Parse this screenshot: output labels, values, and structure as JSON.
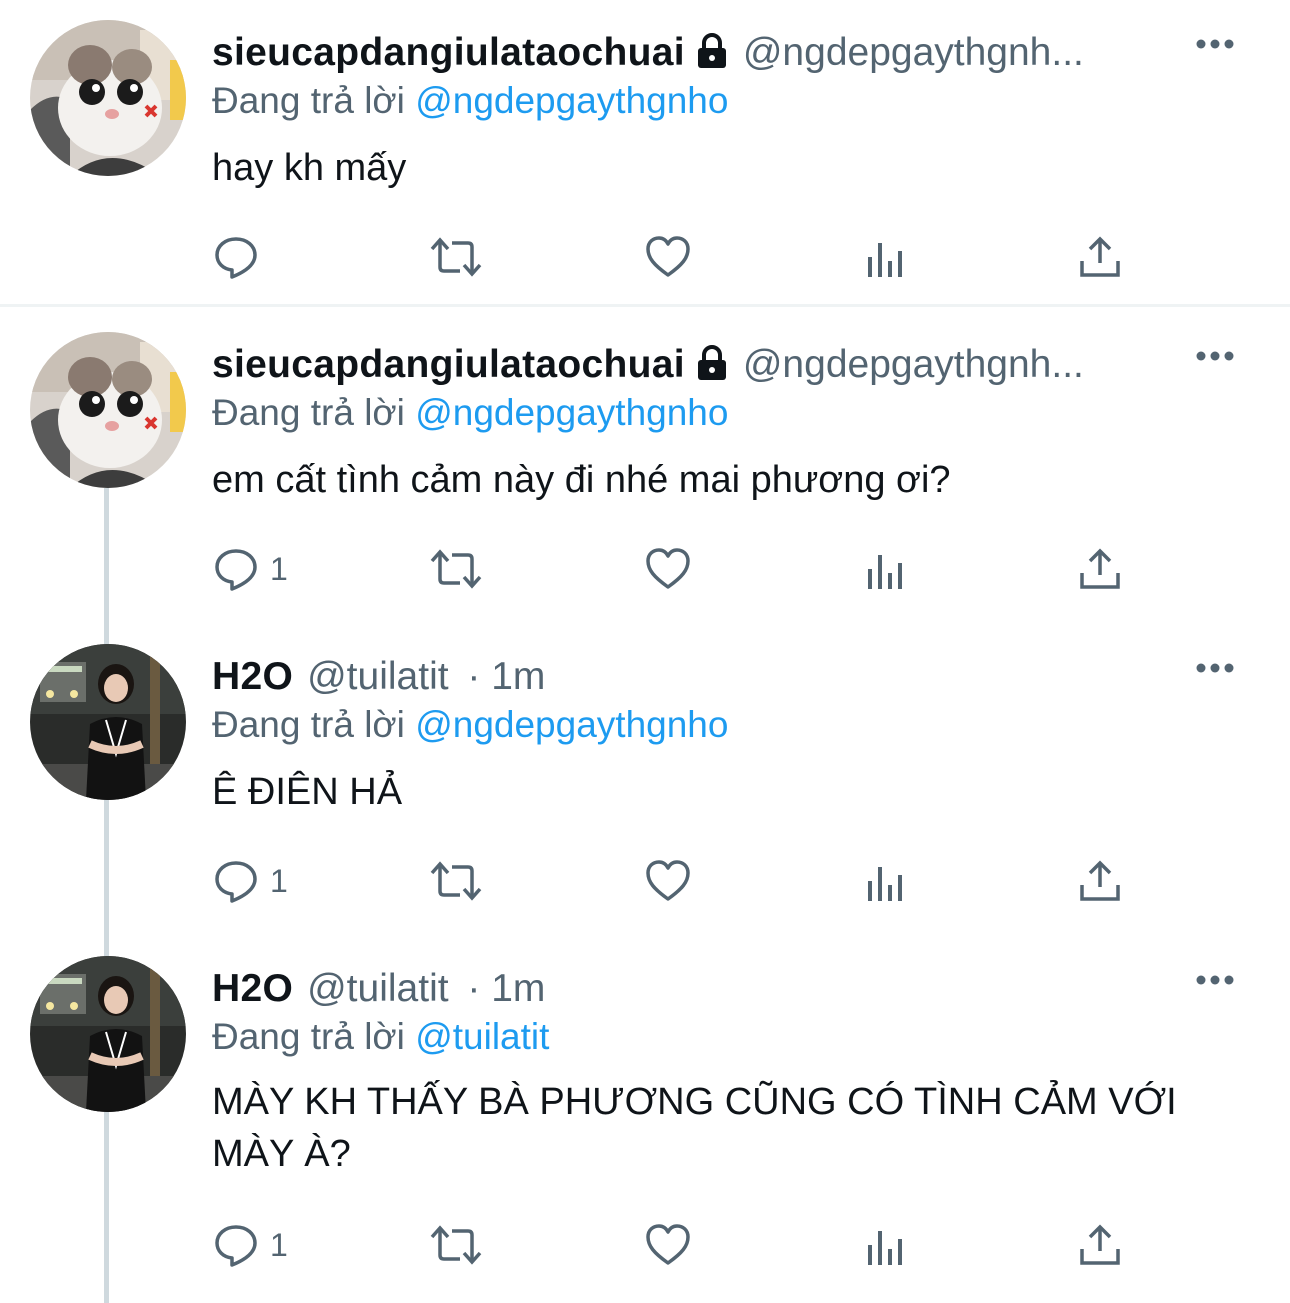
{
  "tweets": [
    {
      "name": "sieucapdangiulataochuai",
      "locked": true,
      "handle": "@ngdepgaythgnh...",
      "time": "",
      "replying_prefix": "Đang trả lời",
      "replying_to": "@ngdepgaythgnho",
      "text": "hay kh mấy",
      "reply_count": "",
      "avatar": "cat-avatar"
    },
    {
      "name": "sieucapdangiulataochuai",
      "locked": true,
      "handle": "@ngdepgaythgnh...",
      "time": "",
      "replying_prefix": "Đang trả lời",
      "replying_to": "@ngdepgaythgnho",
      "text": "em cất tình cảm này đi nhé mai phương ơi?",
      "reply_count": "1",
      "avatar": "cat-avatar"
    },
    {
      "name": "H2O",
      "locked": false,
      "handle": "@tuilatit",
      "time": "· 1m",
      "replying_prefix": "Đang trả lời",
      "replying_to": "@ngdepgaythgnho",
      "text": "Ê ĐIÊN HẢ",
      "reply_count": "1",
      "avatar": "girl-avatar"
    },
    {
      "name": "H2O",
      "locked": false,
      "handle": "@tuilatit",
      "time": "· 1m",
      "replying_prefix": "Đang trả lời",
      "replying_to": "@tuilatit",
      "text": "MÀY KH THẤY BÀ PHƯƠNG CŨNG CÓ TÌNH CẢM VỚI MÀY À?",
      "reply_count": "1",
      "avatar": "girl-avatar"
    }
  ],
  "icons": {
    "reply": "reply-icon",
    "retweet": "retweet-icon",
    "like": "heart-icon",
    "views": "views-icon",
    "share": "share-icon",
    "more": "more-icon",
    "lock": "lock-icon"
  },
  "colors": {
    "link": "#1d9bf0",
    "secondary": "#536471",
    "text": "#0f1419",
    "thread_line": "#cfd9de",
    "divider": "#eff3f4"
  }
}
